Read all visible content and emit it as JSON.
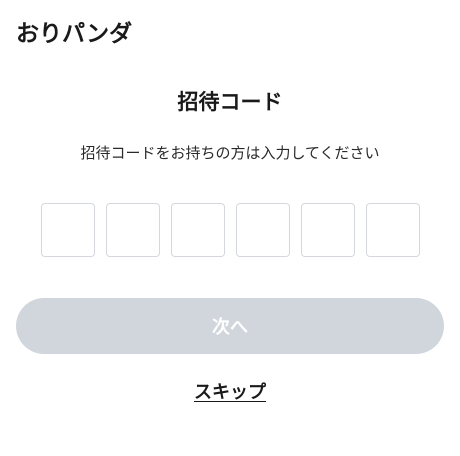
{
  "app": {
    "logo_text": "おりパンダ"
  },
  "invite": {
    "title": "招待コード",
    "description": "招待コードをお持ちの方は入力してください",
    "code_boxes": [
      "",
      "",
      "",
      "",
      "",
      ""
    ]
  },
  "actions": {
    "next_label": "次へ",
    "skip_label": "スキップ"
  },
  "colors": {
    "button_disabled": "#d1d6dd",
    "box_border": "#d4d8dc"
  }
}
